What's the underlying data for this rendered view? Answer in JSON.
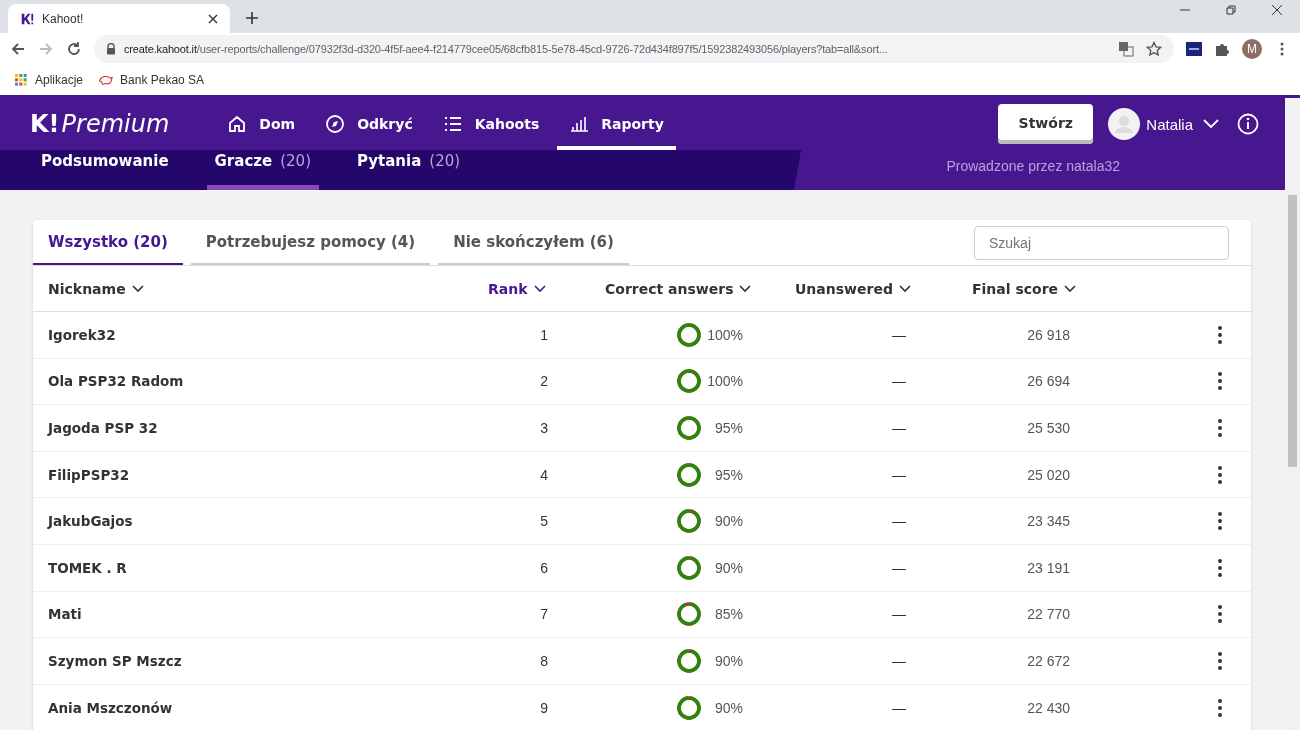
{
  "browser": {
    "tab": {
      "title": "Kahoot!"
    },
    "url_host": "create.kahoot.it",
    "url_path": "/user-reports/challenge/07932f3d-d320-4f5f-aee4-f214779cee05/68cfb815-5e78-45cd-9726-72d434f897f5/1592382493056/players?tab=all&sort...",
    "profile_initial": "M",
    "bookmarks": [
      "Aplikacje",
      "Bank Pekao SA"
    ]
  },
  "nav": {
    "logo_mark": "K!",
    "logo": "Premium",
    "items": [
      {
        "label": "Dom",
        "selected": false
      },
      {
        "label": "Odkryć",
        "selected": false
      },
      {
        "label": "Kahoots",
        "selected": false
      },
      {
        "label": "Raporty",
        "selected": true
      }
    ],
    "create_button": "Stwórz",
    "user": "Natalia"
  },
  "subnav": {
    "tabs": [
      {
        "label": "Podsumowanie",
        "selected": false
      },
      {
        "label": "Gracze",
        "count": "(20)",
        "selected": true
      },
      {
        "label": "Pytania",
        "count": "(20)",
        "selected": false
      }
    ],
    "host": "Prowadzone przez natala32"
  },
  "filters": [
    {
      "label": "Wszystko (20)",
      "selected": true
    },
    {
      "label": "Potrzebujesz pomocy (4)",
      "selected": false
    },
    {
      "label": "Nie skończyłem (6)",
      "selected": false
    }
  ],
  "search": {
    "placeholder": "Szukaj"
  },
  "columns": [
    {
      "label": "Nickname",
      "sorted": false
    },
    {
      "label": "Rank",
      "sorted": true
    },
    {
      "label": "Correct answers",
      "sorted": false
    },
    {
      "label": "Unanswered",
      "sorted": false
    },
    {
      "label": "Final score",
      "sorted": false
    }
  ],
  "rows": [
    {
      "nickname": "Igorek32",
      "rank": "1",
      "level": 1,
      "correct": "100%",
      "unanswered": "—",
      "score": "26 918"
    },
    {
      "nickname": "Ola PSP32 Radom",
      "rank": "2",
      "level": 1,
      "correct": "100%",
      "unanswered": "—",
      "score": "26 694"
    },
    {
      "nickname": "Jagoda PSP 32",
      "rank": "3",
      "level": 0.99,
      "correct": "95%",
      "unanswered": "—",
      "score": "25 530"
    },
    {
      "nickname": "FilipPSP32",
      "rank": "4",
      "level": 0.99,
      "correct": "95%",
      "unanswered": "—",
      "score": "25 020"
    },
    {
      "nickname": "JakubGajos",
      "rank": "5",
      "level": 0.98,
      "correct": "90%",
      "unanswered": "—",
      "score": "23 345"
    },
    {
      "nickname": "TOMEK . R",
      "rank": "6",
      "level": 0.98,
      "correct": "90%",
      "unanswered": "—",
      "score": "23 191"
    },
    {
      "nickname": "Mati",
      "rank": "7",
      "level": 0.95,
      "correct": "85%",
      "unanswered": "—",
      "score": "22 770"
    },
    {
      "nickname": "Szymon SP Mszcz",
      "rank": "8",
      "level": 0.98,
      "correct": "90%",
      "unanswered": "—",
      "score": "22 672"
    },
    {
      "nickname": "Ania Mszczonów",
      "rank": "9",
      "level": 0.98,
      "correct": "90%",
      "unanswered": "—",
      "score": "22 430"
    }
  ]
}
